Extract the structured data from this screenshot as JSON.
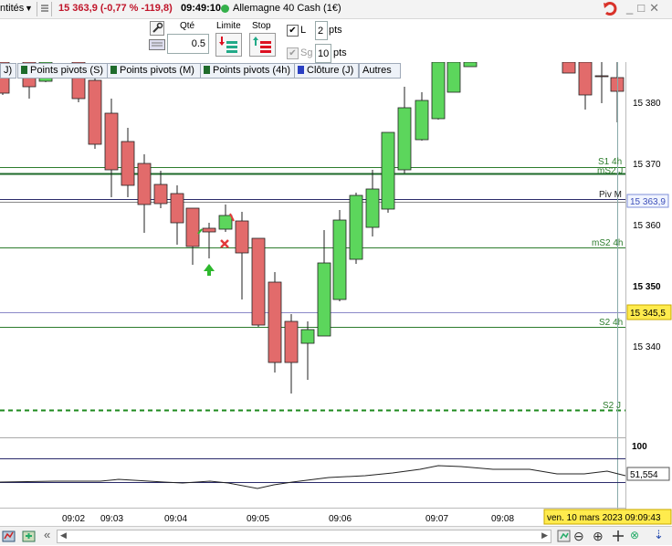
{
  "topbar": {
    "units": "ntités",
    "price_change": "15 363,9 (-0,77 % -119,8)",
    "time": "09:49:10",
    "instrument": "Allemagne 40 Cash (1€)"
  },
  "order": {
    "qty_label": "Qté",
    "qty_value": "0.5",
    "limit_label": "Limite",
    "stop_label": "Stop",
    "l_label": "L",
    "l_value": "2",
    "l_unit": "pts",
    "sg_label": "Sg",
    "sg_value": "10",
    "sg_unit": "pts"
  },
  "tabs": [
    {
      "label": "J)",
      "color": ""
    },
    {
      "label": "Points pivots (S)",
      "color": "#1f6b2b"
    },
    {
      "label": "Points pivots (M)",
      "color": "#1f6b2b"
    },
    {
      "label": "Points pivots (4h)",
      "color": "#1f6b2b"
    },
    {
      "label": "Clôture (J)",
      "color": "#2a3fc2"
    },
    {
      "label": "Autres",
      "color": ""
    }
  ],
  "price_axis": {
    "ticks": [
      "15 380",
      "15 370",
      "15 360",
      "15 350",
      "15 340"
    ],
    "current_price": "15 363,9",
    "close_price": "15 345,5"
  },
  "pivot_labels": [
    "S1 4h",
    "mS2 J",
    "Piv M",
    "mS2 4h",
    "S2 4h",
    "S2 J"
  ],
  "time_axis": [
    "09:02",
    "09:03",
    "09:04",
    "09:05",
    "09:06",
    "09:07",
    "09:08"
  ],
  "indicator": {
    "level_label": "100",
    "value": "51,554"
  },
  "cursor_date": "ven. 10 mars 2023 09:09:43",
  "colors": {
    "bear": "#e26b6b",
    "bull": "#5cd65c",
    "pivot_green": "#2d7d2d",
    "accent_price": "#c0152a"
  }
}
